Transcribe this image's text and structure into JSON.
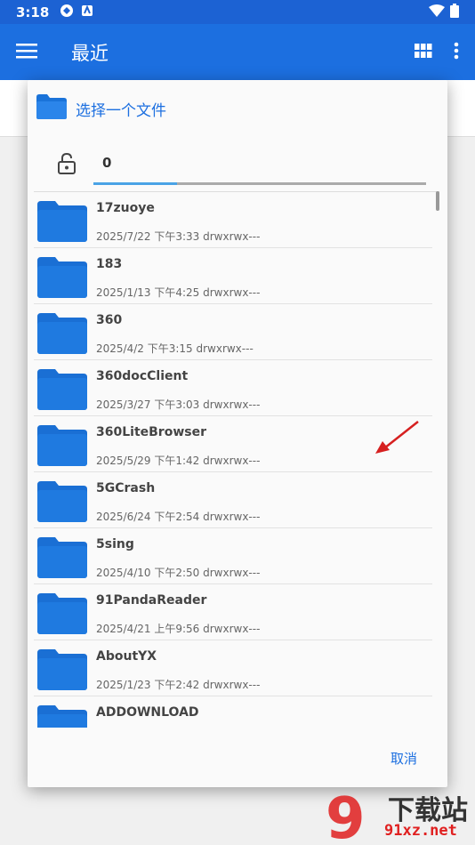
{
  "status_bar": {
    "time": "3:18"
  },
  "app_bar": {
    "title": "最近"
  },
  "dialog": {
    "title": "选择一个文件",
    "path": "0",
    "cancel_label": "取消",
    "files": [
      {
        "name": "17zuoye",
        "meta": "2025/7/22 下午3:33  drwxrwx---"
      },
      {
        "name": "183",
        "meta": "2025/1/13 下午4:25  drwxrwx---"
      },
      {
        "name": "360",
        "meta": "2025/4/2 下午3:15  drwxrwx---"
      },
      {
        "name": "360docClient",
        "meta": "2025/3/27 下午3:03  drwxrwx---"
      },
      {
        "name": "360LiteBrowser",
        "meta": "2025/5/29 下午1:42  drwxrwx---"
      },
      {
        "name": "5GCrash",
        "meta": "2025/6/24 下午2:54  drwxrwx---"
      },
      {
        "name": "5sing",
        "meta": "2025/4/10 下午2:50  drwxrwx---"
      },
      {
        "name": "91PandaReader",
        "meta": "2025/4/21 上午9:56  drwxrwx---"
      },
      {
        "name": "AboutYX",
        "meta": "2025/1/23 下午2:42  drwxrwx---"
      },
      {
        "name": "ADDOWNLOAD",
        "meta": ""
      }
    ]
  },
  "watermark": {
    "line1": "下载站",
    "line2": "91xz.net"
  },
  "colors": {
    "primary": "#1c6fe0",
    "status": "#1c62d3",
    "folder": "#1a73d9"
  }
}
